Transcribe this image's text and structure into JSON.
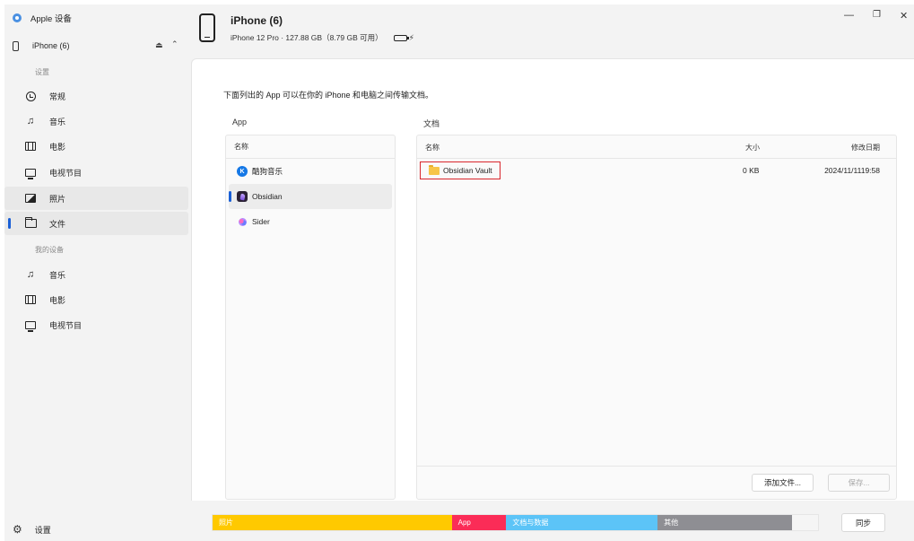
{
  "sidebar": {
    "app_title": "Apple 设备",
    "device_name": "iPhone (6)",
    "section_settings": "设置",
    "section_my_devices": "我的设备",
    "settings_items": [
      {
        "label": "常规",
        "icon": "clock-icon"
      },
      {
        "label": "音乐",
        "icon": "music-note-icon"
      },
      {
        "label": "电影",
        "icon": "film-icon"
      },
      {
        "label": "电视节目",
        "icon": "tv-icon"
      },
      {
        "label": "照片",
        "icon": "photo-icon"
      },
      {
        "label": "文件",
        "icon": "folder-icon"
      }
    ],
    "device_items": [
      {
        "label": "音乐",
        "icon": "music-note-icon"
      },
      {
        "label": "电影",
        "icon": "film-icon"
      },
      {
        "label": "电视节目",
        "icon": "tv-icon"
      }
    ],
    "settings_label": "设置"
  },
  "header": {
    "device_name": "iPhone (6)",
    "device_info": "iPhone 12 Pro · 127.88 GB（8.79 GB 可用）",
    "battery_charging": true
  },
  "main": {
    "description": "下面列出的 App 可以在你的 iPhone 和电脑之间传输文档。",
    "app_column_label": "App",
    "docs_column_label": "文档",
    "app_table_header": "名称",
    "apps": [
      {
        "name": "酷狗音乐",
        "icon": "kugou-icon"
      },
      {
        "name": "Obsidian",
        "icon": "obsidian-icon"
      },
      {
        "name": "Sider",
        "icon": "sider-icon"
      }
    ],
    "selected_app": "Obsidian",
    "file_headers": {
      "name": "名称",
      "size": "大小",
      "modified": "修改日期"
    },
    "files": [
      {
        "name": "Obsidian Vault",
        "size": "0 KB",
        "modified": "2024/11/1119:58"
      }
    ],
    "add_file_button": "添加文件...",
    "save_button": "保存..."
  },
  "storage": {
    "segments": [
      {
        "label": "照片",
        "color": "#ffc900",
        "fraction": 0.395
      },
      {
        "label": "App",
        "color": "#fb2c57",
        "fraction": 0.09
      },
      {
        "label": "文档与数据",
        "color": "#5cc4f7",
        "fraction": 0.25
      },
      {
        "label": "其他",
        "color": "#8e8e93",
        "fraction": 0.222
      }
    ],
    "sync_button": "同步"
  },
  "colors": {
    "accent": "#1a5fd6",
    "highlight_border": "#d9262c"
  }
}
